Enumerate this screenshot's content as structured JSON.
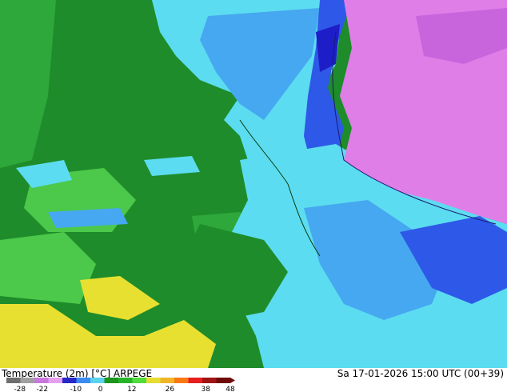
{
  "header": {
    "title": "Temperature (2m) [°C] ARPEGE",
    "valid_time": "Sa 17-01-2026 15:00 UTC (00+39)"
  },
  "legend": {
    "ticks": [
      "-28",
      "-22",
      "-10",
      "0",
      "12",
      "26",
      "38",
      "48"
    ],
    "colors": {
      "min": "#6e6e6e",
      "n28": "#a0a0a0",
      "n22": "#c878dc",
      "n16": "#e6a0f0",
      "n10": "#2828c8",
      "n5": "#3c8cf0",
      "n2": "#5ad2f0",
      "zero": "#1e961e",
      "p4": "#28b428",
      "p8": "#50dc3c",
      "p12": "#e6dc32",
      "p18": "#f0b428",
      "p24": "#fa7814",
      "p30": "#e61e1e",
      "p38": "#a01414",
      "p48": "#6e0a0a"
    }
  },
  "map_colors": {
    "deep_green": "#1e8c2a",
    "mid_green": "#2ea83a",
    "light_green": "#4cc94a",
    "cyan": "#5cdcf0",
    "light_blue": "#46a8f0",
    "blue": "#2e58e8",
    "dark_blue": "#1e1ec8",
    "magenta": "#e07ee8",
    "violet": "#c864dc",
    "yellow": "#e8e030"
  }
}
